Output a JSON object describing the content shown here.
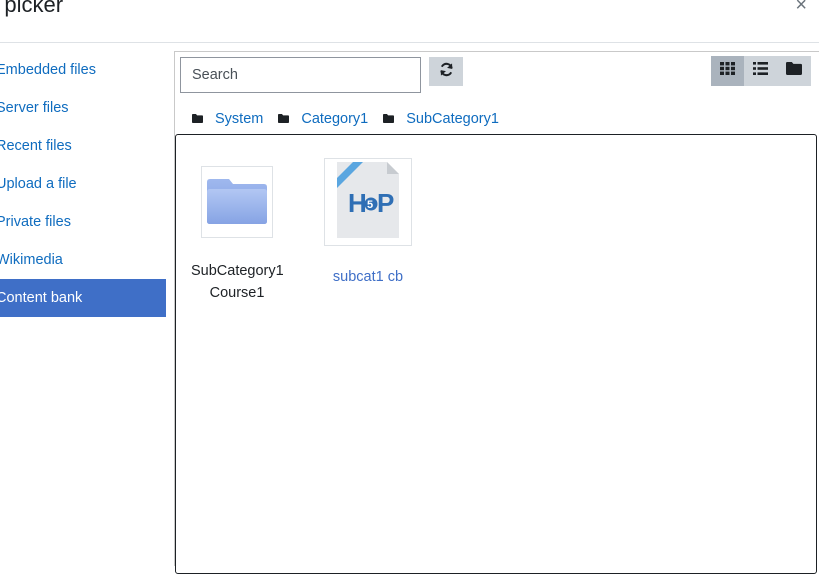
{
  "dialog": {
    "title": "e picker",
    "close_glyph": "×"
  },
  "sidebar": {
    "items": [
      {
        "label": "Embedded files",
        "active": false
      },
      {
        "label": "Server files",
        "active": false
      },
      {
        "label": "Recent files",
        "active": false
      },
      {
        "label": "Upload a file",
        "active": false
      },
      {
        "label": "Private files",
        "active": false
      },
      {
        "label": "Wikimedia",
        "active": false
      },
      {
        "label": "Content bank",
        "active": true
      }
    ]
  },
  "toolbar": {
    "search_placeholder": "Search",
    "search_value": "",
    "refresh_icon": "refresh-icon",
    "view_modes": [
      "icons",
      "list",
      "tree"
    ],
    "active_view": "icons"
  },
  "breadcrumb": [
    "System",
    "Category1",
    "SubCategory1"
  ],
  "files": [
    {
      "name_line1": "SubCategory1",
      "name_line2": "Course1",
      "type": "folder"
    },
    {
      "name_line1": "subcat1 cb",
      "name_line2": "",
      "type": "h5p"
    }
  ],
  "colors": {
    "accent": "#3f6fc7",
    "link": "#0f6cbf",
    "button_bg": "#ced4da"
  }
}
